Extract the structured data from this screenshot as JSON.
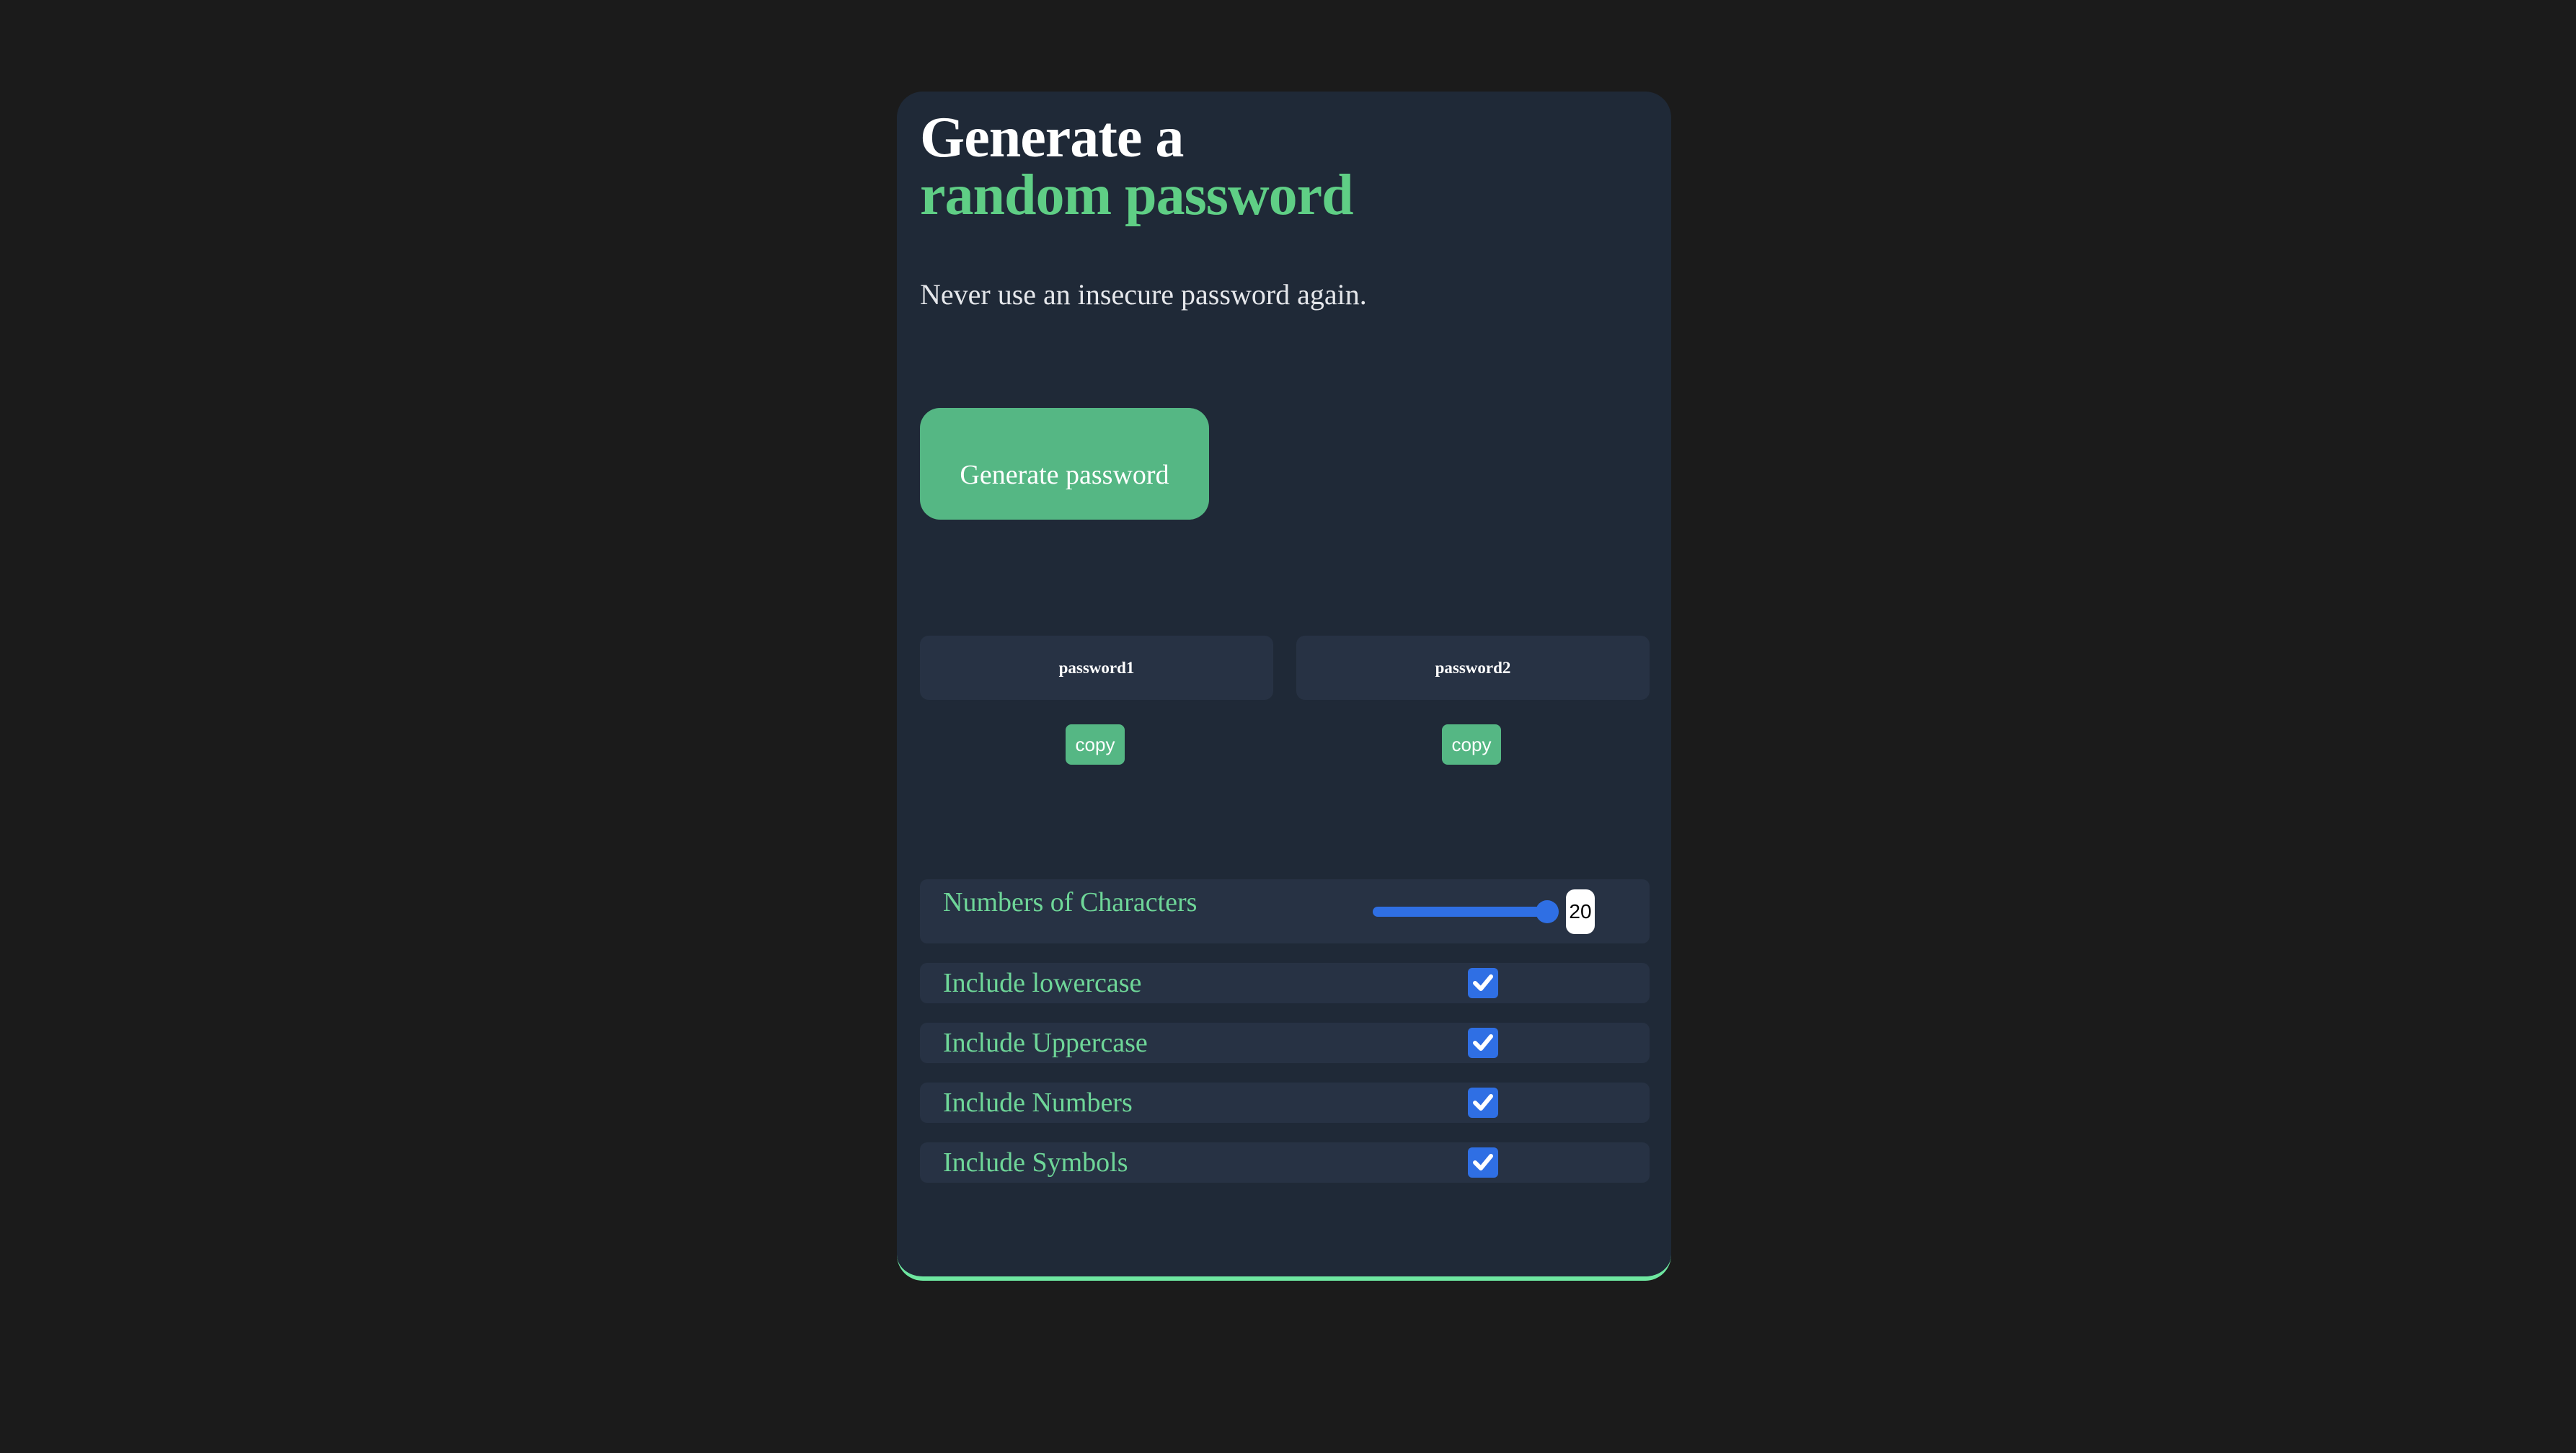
{
  "header": {
    "title_line1": "Generate a",
    "title_line2": "random password",
    "subtitle": "Never use an insecure password again."
  },
  "generate_button": {
    "label": "Generate password"
  },
  "passwords": [
    {
      "value": "password1",
      "copy_label": "copy"
    },
    {
      "value": "password2",
      "copy_label": "copy"
    }
  ],
  "options": {
    "length": {
      "label": "Numbers of Characters",
      "value": "20",
      "slider_fraction": 1.0
    },
    "toggles": [
      {
        "label": "Include lowercase",
        "checked": true
      },
      {
        "label": "Include Uppercase",
        "checked": true
      },
      {
        "label": "Include Numbers",
        "checked": true
      },
      {
        "label": "Include Symbols",
        "checked": true
      }
    ]
  },
  "colors": {
    "background": "#1b1b1b",
    "card": "#1f2937",
    "accent_green": "#5fce85",
    "button_green": "#55b784",
    "checkbox_blue": "#2f6fe4"
  }
}
